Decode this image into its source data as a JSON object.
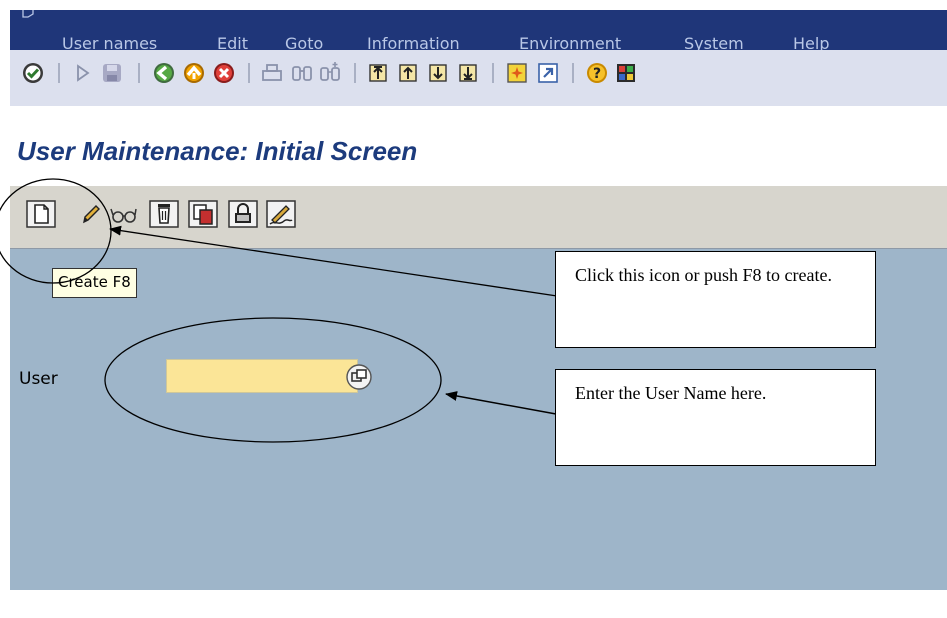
{
  "menu": {
    "items": [
      "User names",
      "Edit",
      "Goto",
      "Information",
      "Environment",
      "System",
      "Help"
    ]
  },
  "toolbar": {
    "buttons": [
      "enter",
      "back-arrow",
      "save",
      "back",
      "exit",
      "cancel",
      "print",
      "find",
      "find-next",
      "first-page",
      "previous-page",
      "next-page",
      "last-page",
      "create-session",
      "shortcut",
      "help",
      "customize-layout"
    ]
  },
  "title": "User Maintenance: Initial Screen",
  "app_toolbar": {
    "buttons": [
      "create",
      "change",
      "display",
      "delete",
      "copy",
      "lock-unlock",
      "change-password"
    ]
  },
  "tooltip": "Create  F8",
  "user_field": {
    "label": "User",
    "value": ""
  },
  "callouts": {
    "create": "Click this icon or push F8 to create.",
    "user": "Enter the User Name here."
  }
}
